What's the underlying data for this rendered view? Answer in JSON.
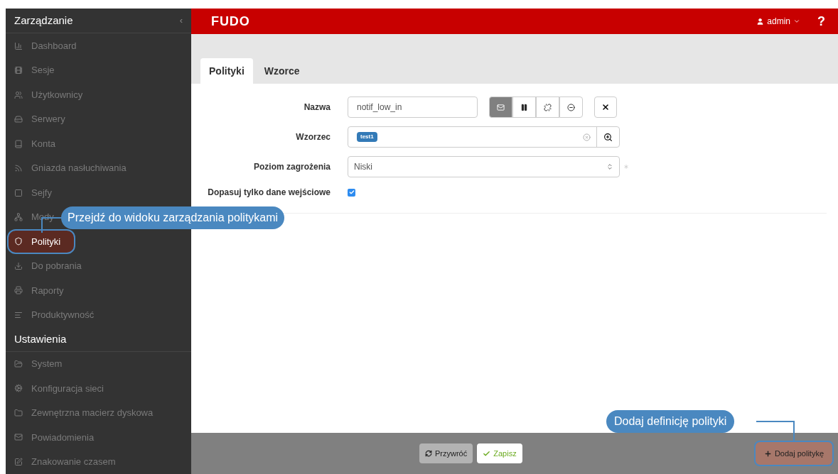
{
  "sidebar": {
    "title": "Zarządzanie",
    "collapse": "‹",
    "items": [
      {
        "label": "Dashboard",
        "selected": false
      },
      {
        "label": "Sesje",
        "selected": false
      },
      {
        "label": "Użytkownicy",
        "selected": false
      },
      {
        "label": "Serwery",
        "selected": false
      },
      {
        "label": "Konta",
        "selected": false
      },
      {
        "label": "Gniazda nasłuchiwania",
        "selected": false
      },
      {
        "label": "Sejfy",
        "selected": false
      },
      {
        "label": "Mody",
        "selected": false
      },
      {
        "label": "Polityki",
        "selected": true
      },
      {
        "label": "Do pobrania",
        "selected": false
      },
      {
        "label": "Raporty",
        "selected": false
      },
      {
        "label": "Produktywność",
        "selected": false
      }
    ],
    "section": "Ustawienia",
    "settings": [
      {
        "label": "System",
        "selected": false
      },
      {
        "label": "Konfiguracja sieci",
        "selected": false
      },
      {
        "label": "Zewnętrzna macierz dyskowa",
        "selected": false
      },
      {
        "label": "Powiadomienia",
        "selected": false
      },
      {
        "label": "Znakowanie czasem",
        "selected": false
      }
    ]
  },
  "header": {
    "logo": "FUDO",
    "user": "admin",
    "help": "?"
  },
  "tabs": [
    {
      "label": "Polityki",
      "selected": true
    },
    {
      "label": "Wzorce",
      "selected": false
    }
  ],
  "form": {
    "name_label": "Nazwa",
    "name_value": "notif_low_in",
    "actions": [
      {
        "selected": true
      },
      {
        "selected": false
      },
      {
        "selected": false
      },
      {
        "selected": false
      }
    ],
    "pattern_label": "Wzorzec",
    "pattern_tag": "test1",
    "level_label": "Poziom zagrożenia",
    "level_value": "Niski",
    "input_only_label": "Dopasuj tylko dane wejściowe",
    "input_only_checked": true
  },
  "footer": {
    "revert": "Przywróć",
    "save": "Zapisz",
    "add": "Dodaj politykę"
  },
  "callouts": [
    {
      "text": "Przejdź do widoku zarządzania politykami"
    },
    {
      "text": "Dodaj definicję polityki"
    }
  ]
}
